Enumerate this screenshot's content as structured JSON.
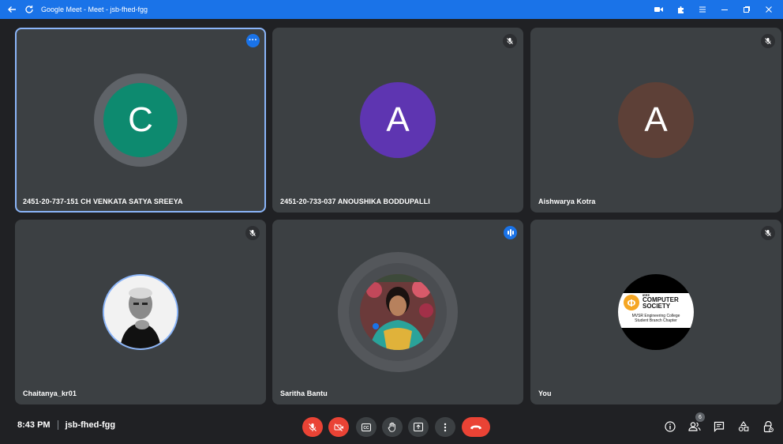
{
  "window": {
    "title": "Google Meet - Meet - jsb-fhed-fgg"
  },
  "tiles": [
    {
      "name": "2451-20-737-151 CH VENKATA SATYA SREEYA",
      "initial": "C",
      "avatar_color": "#0d8a6f",
      "state": "more-options",
      "active": true
    },
    {
      "name": "2451-20-733-037 ANOUSHIKA BODDUPALLI",
      "initial": "A",
      "avatar_color": "#5e35b1",
      "state": "muted"
    },
    {
      "name": "Aishwarya Kotra",
      "initial": "A",
      "avatar_color": "#5d4037",
      "state": "muted"
    },
    {
      "name": "Chaitanya_kr01",
      "state": "muted"
    },
    {
      "name": "Saritha Bantu",
      "state": "speaking"
    },
    {
      "name": "You",
      "state": "muted",
      "logo": {
        "line1": "IEEE",
        "line2": "COMPUTER",
        "line3": "SOCIETY",
        "line4": "MVSR Engineering College",
        "line5": "Student Branch Chapter"
      }
    }
  ],
  "bottom": {
    "time": "8:43 PM",
    "meeting_code": "jsb-fhed-fgg",
    "participants_count": "6"
  },
  "colors": {
    "accent": "#1a73e8",
    "danger": "#ea4335",
    "tile_bg": "#3c4043",
    "page_bg": "#202124"
  }
}
